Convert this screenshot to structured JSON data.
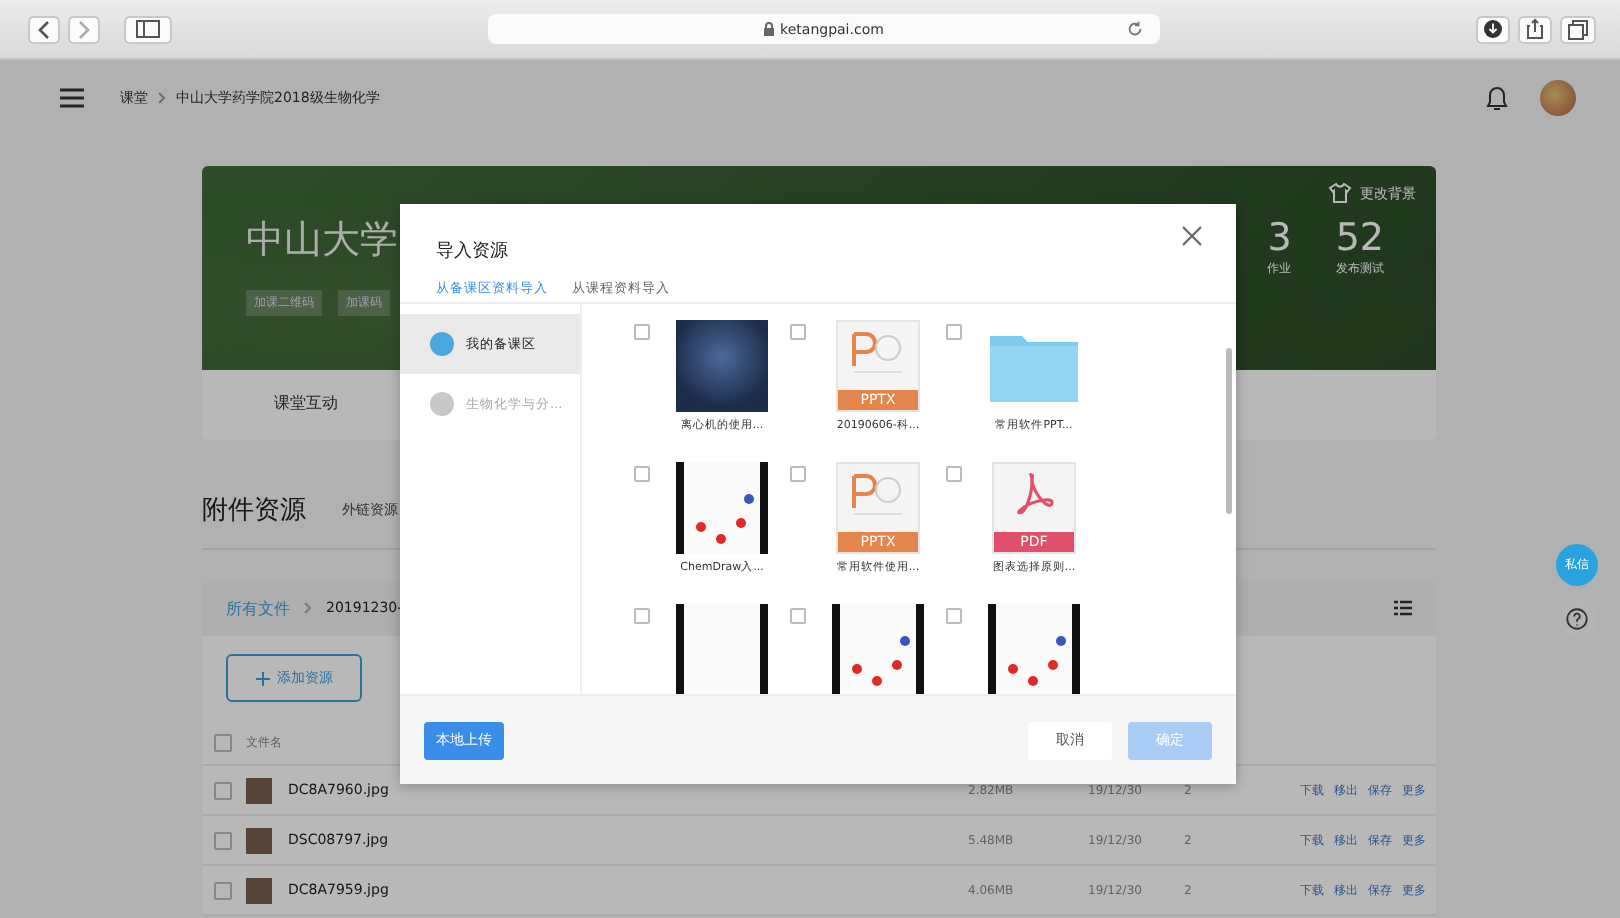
{
  "browser": {
    "url": "ketangpai.com"
  },
  "header": {
    "breadcrumb": [
      {
        "label": "课堂"
      },
      {
        "label": "中山大学药学院2018级生物化学"
      }
    ]
  },
  "course": {
    "title": "中山大学",
    "badges": [
      "加课二维码",
      "加课码"
    ],
    "change_background": "更改背景",
    "stats": [
      {
        "value": "3",
        "label": "作业"
      },
      {
        "value": "52",
        "label": "发布测试"
      }
    ],
    "tabs": [
      {
        "label": "课堂互动",
        "selected": false
      }
    ]
  },
  "section": {
    "title": "附件资源",
    "tabs": [
      {
        "label": "外链资源"
      }
    ]
  },
  "files": {
    "path": [
      {
        "label": "所有文件"
      },
      {
        "label": "20191230-"
      }
    ],
    "add_button": "添加资源",
    "select_all_checked": false,
    "column": "文件名",
    "rows": [
      {
        "name": "DC8A7960.jpg",
        "size": "2.82MB",
        "date": "19/12/30",
        "count": "2",
        "checked": false,
        "actions": [
          "下载",
          "移出",
          "保存",
          "更多"
        ]
      },
      {
        "name": "DSC08797.jpg",
        "size": "5.48MB",
        "date": "19/12/30",
        "count": "2",
        "checked": false,
        "actions": [
          "下载",
          "移出",
          "保存",
          "更多"
        ]
      },
      {
        "name": "DC8A7959.jpg",
        "size": "4.06MB",
        "date": "19/12/30",
        "count": "2",
        "checked": false,
        "actions": [
          "下载",
          "移出",
          "保存",
          "更多"
        ]
      }
    ]
  },
  "floating": {
    "message": "私信"
  },
  "dialog": {
    "title": "导入资源",
    "tabs": [
      {
        "label": "从备课区资料导入",
        "selected": true
      },
      {
        "label": "从课程资料导入",
        "selected": false
      }
    ],
    "sources": [
      {
        "label": "我的备课区",
        "selected": true
      },
      {
        "label": "生物化学与分...",
        "selected": false
      }
    ],
    "items": [
      {
        "kind": "photo",
        "name": "离心机的使用...",
        "checked": false
      },
      {
        "kind": "pptx",
        "badge": "PPTX",
        "name": "20190606-科...",
        "checked": false
      },
      {
        "kind": "folder",
        "name": "常用软件PPT...",
        "checked": false
      },
      {
        "kind": "slide",
        "name": "ChemDraw入...",
        "checked": false
      },
      {
        "kind": "pptx",
        "badge": "PPTX",
        "name": "常用软件使用...",
        "checked": false
      },
      {
        "kind": "pdf",
        "badge": "PDF",
        "name": "图表选择原则...",
        "checked": false
      },
      {
        "kind": "blank",
        "checked": false
      },
      {
        "kind": "slide",
        "checked": false
      },
      {
        "kind": "slide",
        "checked": false
      }
    ],
    "upload_button": "本地上传",
    "cancel_button": "取消",
    "confirm_button": {
      "label": "确定",
      "disabled": true
    }
  }
}
